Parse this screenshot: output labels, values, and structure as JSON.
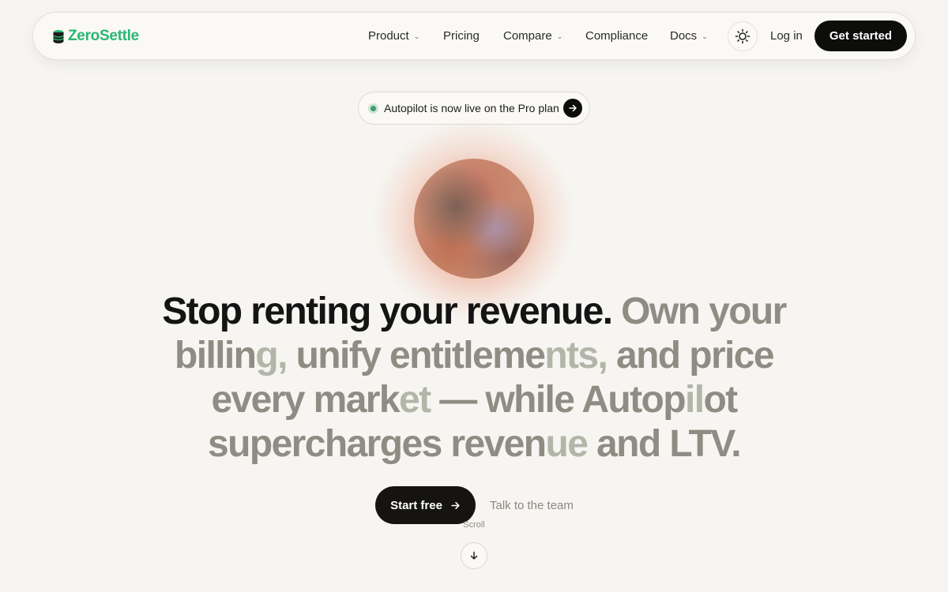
{
  "brand": {
    "name": "ZeroSettle",
    "color": "#2bb673"
  },
  "nav": {
    "items": [
      {
        "label": "Product",
        "dropdown": true
      },
      {
        "label": "Pricing",
        "dropdown": false
      },
      {
        "label": "Compare",
        "dropdown": true
      },
      {
        "label": "Compliance",
        "dropdown": false
      },
      {
        "label": "Docs",
        "dropdown": true
      }
    ],
    "theme_icon": "sun-icon",
    "login_label": "Log in",
    "cta_label": "Get started"
  },
  "announcement": {
    "text": "Autopilot is now live on the Pro plan",
    "status_color": "#3c9f6a",
    "arrow_icon": "arrow-right-icon"
  },
  "hero": {
    "headline_strong": "Stop renting your revenue.",
    "headline_rest_parts": [
      {
        "text": " Own your ",
        "tone": "muted"
      },
      {
        "text": "billin",
        "tone": "muted"
      },
      {
        "text": "g,",
        "tone": "faint"
      },
      {
        "text": " unify entitleme",
        "tone": "muted"
      },
      {
        "text": "nts,",
        "tone": "faint"
      },
      {
        "text": " and price every mark",
        "tone": "muted"
      },
      {
        "text": "et",
        "tone": "faint"
      },
      {
        "text": " — while Autop",
        "tone": "muted"
      },
      {
        "text": "il",
        "tone": "faint"
      },
      {
        "text": "ot supercharges reven",
        "tone": "muted"
      },
      {
        "text": "ue",
        "tone": "faint"
      },
      {
        "text": " and LTV.",
        "tone": "muted"
      }
    ],
    "primary_cta": "Start free",
    "secondary_cta": "Talk to the team",
    "scroll_label": "Scroll"
  },
  "colors": {
    "background": "#f6f5f1",
    "primary_button": "#151410",
    "headline_strong": "#141414",
    "headline_muted": "#8f8c84"
  }
}
